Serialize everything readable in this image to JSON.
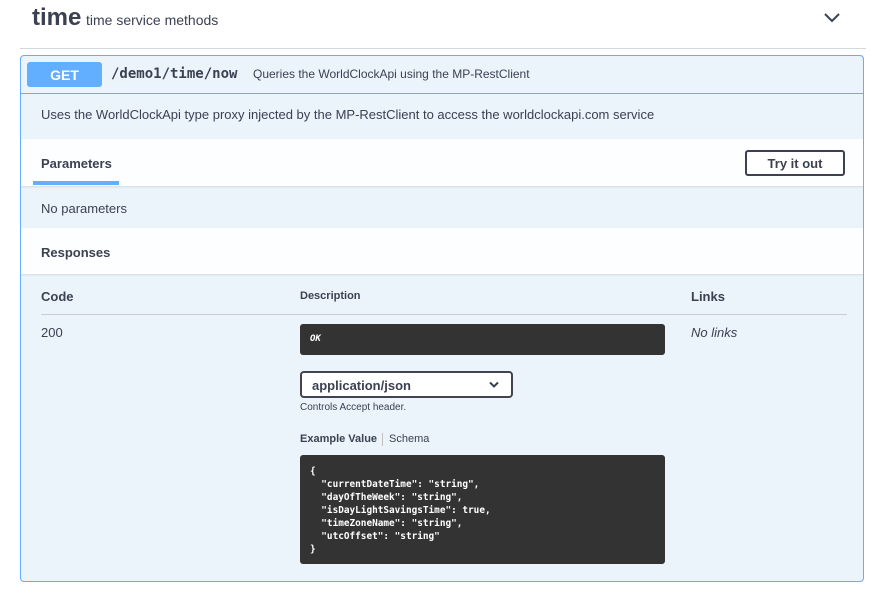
{
  "tag": {
    "name": "time",
    "description": "time service methods"
  },
  "operation": {
    "method": "GET",
    "path": "/demo1/time/now",
    "summary": "Queries the WorldClockApi using the MP-RestClient",
    "description": "Uses the WorldClockApi type proxy injected by the MP-RestClient to access the worldclockapi.com service"
  },
  "parameters": {
    "tab_label": "Parameters",
    "try_button": "Try it out",
    "empty_text": "No parameters"
  },
  "responses": {
    "title": "Responses",
    "columns": {
      "code": "Code",
      "description": "Description",
      "links": "Links"
    },
    "rows": [
      {
        "code": "200",
        "description": "OK",
        "links": "No links",
        "media_type": "application/json",
        "controls_note": "Controls Accept header.",
        "example_tab": "Example Value",
        "schema_tab": "Schema",
        "example": "{\n  \"currentDateTime\": \"string\",\n  \"dayOfTheWeek\": \"string\",\n  \"isDayLightSavingsTime\": true,\n  \"timeZoneName\": \"string\",\n  \"utcOffset\": \"string\"\n}"
      }
    ]
  },
  "colors": {
    "get_accent": "#61affe",
    "opblock_bg": "#ebf3fb",
    "text": "#3b4151",
    "code_bg": "#333333"
  },
  "icons": {
    "tag_toggle": "chevron-down-icon",
    "select_arrow": "chevron-down-icon"
  }
}
